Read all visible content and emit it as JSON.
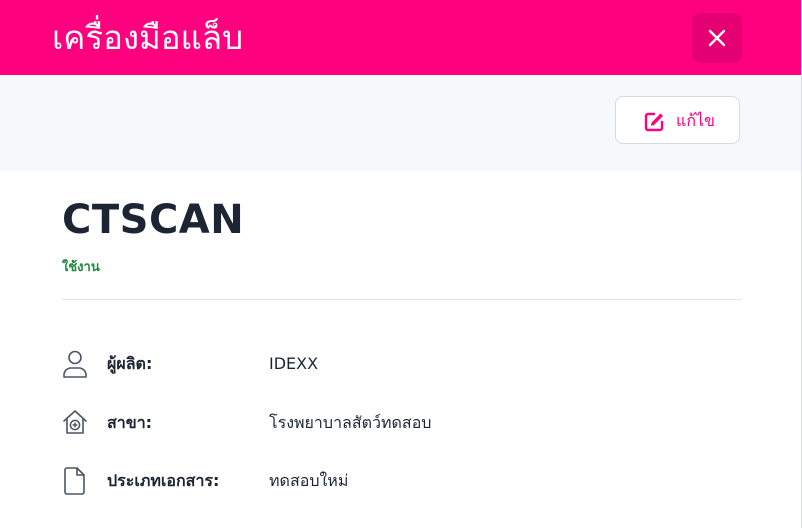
{
  "header": {
    "title": "เครื่องมือแล็บ",
    "close_icon": "close-icon",
    "background_color": "#ff007f"
  },
  "toolbar": {
    "edit_label": "แก้ไข",
    "edit_icon": "edit-icon"
  },
  "record": {
    "name": "CTSCAN",
    "status": "ใช้งาน",
    "status_color": "#1f8a3d"
  },
  "details": [
    {
      "icon": "user-icon",
      "label": "ผู้ผลิต:",
      "value": "IDEXX"
    },
    {
      "icon": "clinic-icon",
      "label": "สาขา:",
      "value": "โรงพยาบาลสัตว์ทดสอบ"
    },
    {
      "icon": "document-icon",
      "label": "ประเภทเอกสาร:",
      "value": "ทดสอบใหม่"
    }
  ]
}
